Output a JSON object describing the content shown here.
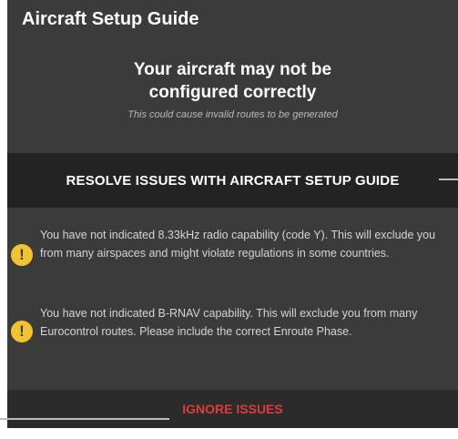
{
  "dialog": {
    "title": "Aircraft Setup Guide",
    "headline_line1": "Your aircraft may not be",
    "headline_line2": "configured correctly",
    "subline": "This could cause invalid routes to be generated",
    "resolve_label": "RESOLVE ISSUES WITH AIRCRAFT SETUP GUIDE",
    "issues": [
      {
        "icon": "warning-icon",
        "icon_glyph": "!",
        "text": "You have not indicated 8.33kHz radio capability (code Y). This will exclude you from many airspaces and might violate regulations in some countries."
      },
      {
        "icon": "warning-icon",
        "icon_glyph": "!",
        "text": "You have not indicated B-RNAV capability. This will exclude you from many Eurocontrol routes. Please include the correct Enroute Phase."
      }
    ],
    "ignore_label": "IGNORE ISSUES"
  },
  "colors": {
    "dialog_bg": "#3b3b3b",
    "band_bg": "#232323",
    "warning": "#f2c230",
    "danger": "#e23a3a"
  }
}
